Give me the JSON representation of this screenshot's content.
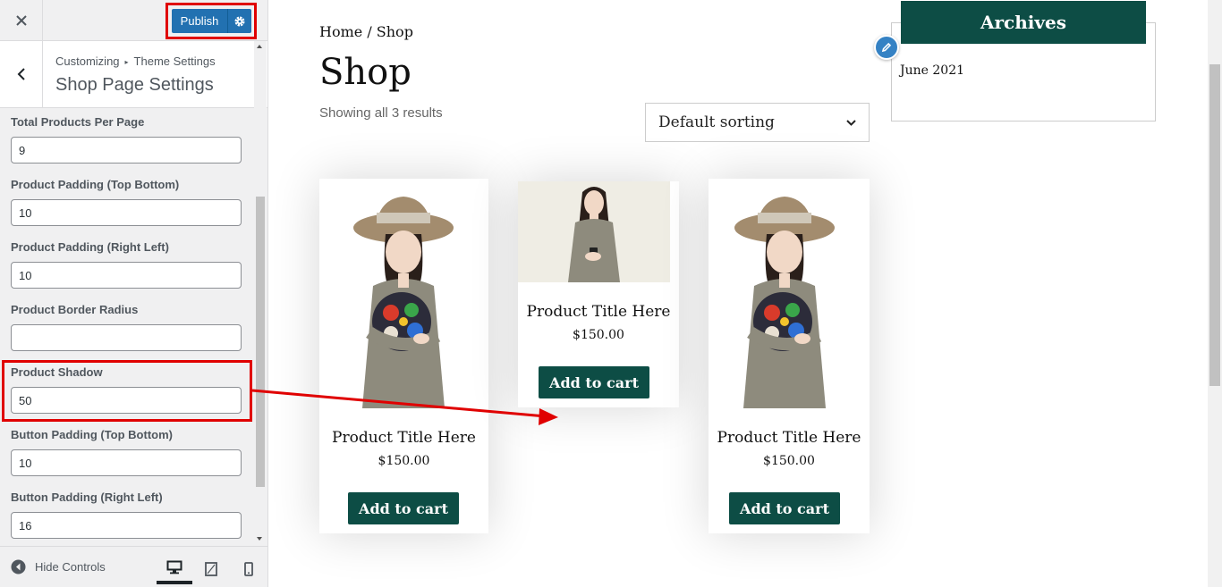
{
  "topbar": {
    "close_icon": "close-icon",
    "publish_label": "Publish",
    "publish_settings_icon": "gear-icon"
  },
  "section": {
    "breadcrumb_root": "Customizing",
    "breadcrumb_sep": "▸",
    "breadcrumb_parent": "Theme Settings",
    "title": "Shop Page Settings"
  },
  "controls": [
    {
      "label": "Total Products Per Page",
      "value": "9"
    },
    {
      "label": "Product Padding (Top Bottom)",
      "value": "10"
    },
    {
      "label": "Product Padding (Right Left)",
      "value": "10"
    },
    {
      "label": "Product Border Radius",
      "value": ""
    },
    {
      "label": "Product Shadow",
      "value": "50"
    },
    {
      "label": "Button Padding (Top Bottom)",
      "value": "10"
    },
    {
      "label": "Button Padding (Right Left)",
      "value": "16"
    }
  ],
  "footer": {
    "hide_controls_label": "Hide Controls",
    "devices": [
      "desktop-icon",
      "tablet-icon",
      "mobile-icon"
    ]
  },
  "preview": {
    "breadcrumb": "Home / Shop",
    "heading": "Shop",
    "result_count": "Showing all 3 results",
    "sorting_selected": "Default sorting",
    "products": [
      {
        "title": "Product Title Here",
        "price": "$150.00",
        "button": "Add to cart"
      },
      {
        "title": "Product Title Here",
        "price": "$150.00",
        "button": "Add to cart"
      },
      {
        "title": "Product Title Here",
        "price": "$150.00",
        "button": "Add to cart"
      }
    ],
    "archives_title": "Archives",
    "archives_items": [
      "June 2021"
    ]
  },
  "colors": {
    "accent": "#2271b1",
    "brand_green": "#0d4d45",
    "highlight_red": "#e00000"
  }
}
